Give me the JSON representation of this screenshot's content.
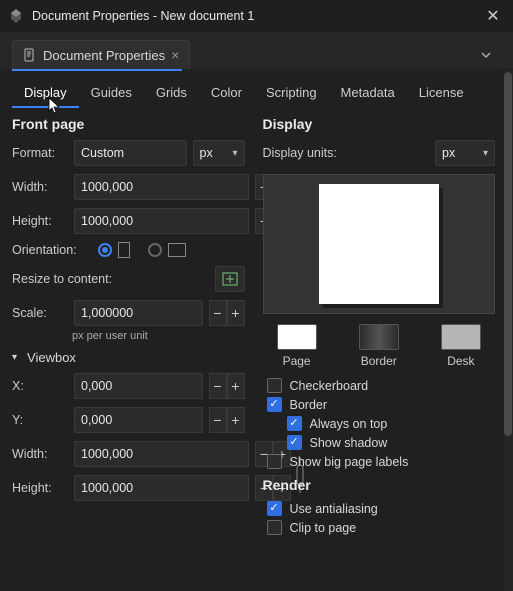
{
  "window": {
    "title": "Document Properties - New document 1"
  },
  "docTab": {
    "label": "Document Properties"
  },
  "tabs": [
    "Display",
    "Guides",
    "Grids",
    "Color",
    "Scripting",
    "Metadata",
    "License"
  ],
  "activeTab": 0,
  "left": {
    "heading": "Front page",
    "format_label": "Format:",
    "format_value": "Custom",
    "unit": "px",
    "width_label": "Width:",
    "width_value": "1000,000",
    "height_label": "Height:",
    "height_value": "1000,000",
    "orientation_label": "Orientation:",
    "resize_label": "Resize to content:",
    "scale_label": "Scale:",
    "scale_value": "1,000000",
    "scale_hint": "px per user unit",
    "viewbox_label": "Viewbox",
    "x_label": "X:",
    "x_value": "0,000",
    "y_label": "Y:",
    "y_value": "0,000",
    "vb_width_label": "Width:",
    "vb_width_value": "1000,000",
    "vb_height_label": "Height:",
    "vb_height_value": "1000,000"
  },
  "right": {
    "heading": "Display",
    "units_label": "Display units:",
    "units_value": "px",
    "swatch_page": "Page",
    "swatch_border": "Border",
    "swatch_desk": "Desk",
    "colors": {
      "page": "#ffffff",
      "border": "#3a3a3a",
      "desk": "#b5b5b5"
    },
    "cb_checker": "Checkerboard",
    "cb_border": "Border",
    "cb_ontop": "Always on top",
    "cb_shadow": "Show shadow",
    "cb_biglabels": "Show big page labels",
    "render_heading": "Render",
    "cb_antialias": "Use antialiasing",
    "cb_clip": "Clip to page",
    "checked": {
      "checker": false,
      "border": true,
      "ontop": true,
      "shadow": true,
      "biglabels": false,
      "antialias": true,
      "clip": false
    }
  }
}
